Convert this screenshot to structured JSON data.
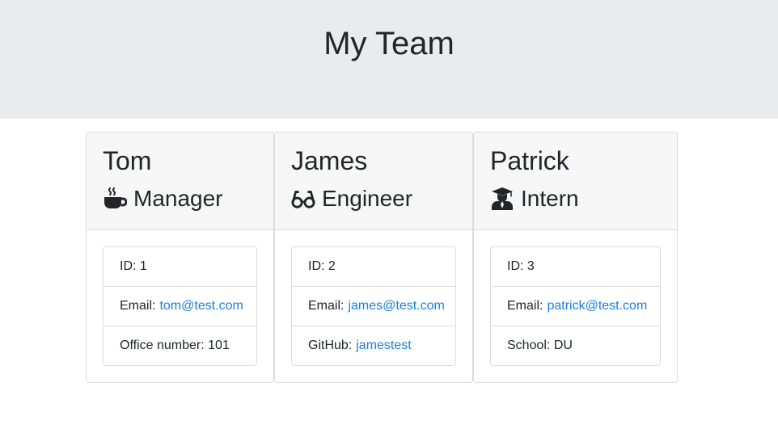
{
  "header": {
    "title": "My Team"
  },
  "team": [
    {
      "name": "Tom",
      "role": "Manager",
      "icon": "coffee-icon",
      "id_label": "ID: 1",
      "email_prefix": "Email:",
      "email": "tom@test.com",
      "extra_label": "Office number: 101",
      "extra_link": ""
    },
    {
      "name": "James",
      "role": "Engineer",
      "icon": "glasses-icon",
      "id_label": "ID: 2",
      "email_prefix": "Email:",
      "email": "james@test.com",
      "extra_label": "GitHub:",
      "extra_link": "jamestest"
    },
    {
      "name": "Patrick",
      "role": "Intern",
      "icon": "graduate-icon",
      "id_label": "ID: 3",
      "email_prefix": "Email:",
      "email": "patrick@test.com",
      "extra_label": "School: DU",
      "extra_link": ""
    }
  ],
  "colors": {
    "header_bg": "#e9ecef",
    "card_header_bg": "#f7f7f7",
    "link": "#1a7fe0",
    "text": "#212529"
  }
}
